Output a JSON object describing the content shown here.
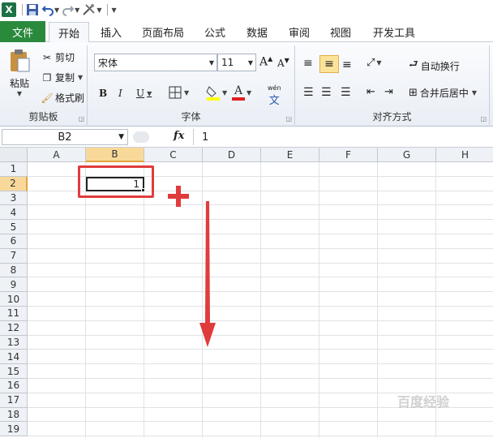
{
  "qat": {
    "logo": "X"
  },
  "tabs": [
    "文件",
    "开始",
    "插入",
    "页面布局",
    "公式",
    "数据",
    "审阅",
    "视图",
    "开发工具"
  ],
  "ribbon": {
    "clipboard": {
      "paste": "粘贴",
      "cut": "剪切",
      "copy": "复制",
      "format_painter": "格式刷",
      "label": "剪贴板"
    },
    "font": {
      "name": "宋体",
      "size": "11",
      "bold": "B",
      "italic": "I",
      "underline": "U",
      "font_color_glyph": "A",
      "phonetic": "wén",
      "label": "字体"
    },
    "alignment": {
      "wrap_text": "自动换行",
      "merge_center": "合并后居中",
      "label": "对齐方式"
    }
  },
  "formula_bar": {
    "name_box": "B2",
    "fx": "fx",
    "value": "1"
  },
  "columns": [
    "A",
    "B",
    "C",
    "D",
    "E",
    "F",
    "G",
    "H"
  ],
  "rows": [
    "1",
    "2",
    "3",
    "4",
    "5",
    "6",
    "7",
    "8",
    "9",
    "10",
    "11",
    "12",
    "13",
    "14",
    "15",
    "16",
    "17",
    "18",
    "19"
  ],
  "cells": {
    "B2": "1"
  },
  "watermark": "百度经验",
  "colors": {
    "file_tab": "#2a8a3c",
    "selection_header": "#f9d99a",
    "annotation": "#e03c3c"
  }
}
